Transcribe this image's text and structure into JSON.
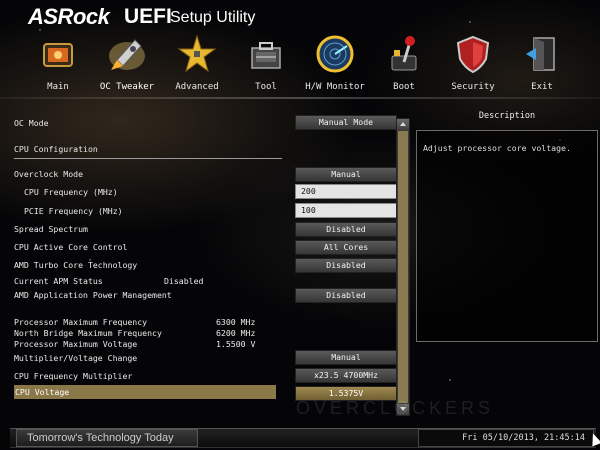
{
  "header": {
    "logo": "ASRock",
    "uefi": "UEFI",
    "subtitle": "Setup Utility"
  },
  "nav": [
    {
      "label": "Main",
      "icon": "main-icon",
      "active": false
    },
    {
      "label": "OC Tweaker",
      "icon": "oc-tweaker-rocket-icon",
      "active": true
    },
    {
      "label": "Advanced",
      "icon": "advanced-star-icon",
      "active": false
    },
    {
      "label": "Tool",
      "icon": "toolbox-icon",
      "active": false
    },
    {
      "label": "H/W Monitor",
      "icon": "radar-icon",
      "active": false
    },
    {
      "label": "Boot",
      "icon": "boot-lever-icon",
      "active": false
    },
    {
      "label": "Security",
      "icon": "shield-icon",
      "active": false
    },
    {
      "label": "Exit",
      "icon": "exit-door-icon",
      "active": false
    }
  ],
  "settings": {
    "oc_mode": {
      "label": "OC Mode",
      "value": "Manual Mode"
    },
    "cpu_configuration": "CPU Configuration",
    "overclock_mode": {
      "label": "Overclock Mode",
      "value": "Manual"
    },
    "cpu_frequency": {
      "label": "CPU Frequency (MHz)",
      "value": "200"
    },
    "pcie_frequency": {
      "label": "PCIE Frequency (MHz)",
      "value": "100"
    },
    "spread_spectrum": {
      "label": "Spread Spectrum",
      "value": "Disabled"
    },
    "cpu_active_core_control": {
      "label": "CPU Active Core Control",
      "value": "All Cores"
    },
    "amd_turbo_core": {
      "label": "AMD Turbo Core Technology",
      "value": "Disabled"
    },
    "current_apm_status": {
      "label": "Current APM Status",
      "value": "Disabled"
    },
    "amd_apm": {
      "label": "AMD Application Power Management",
      "value": "Disabled"
    },
    "processor_max_frequency": {
      "label": "Processor Maximum Frequency",
      "value": "6300 MHz"
    },
    "north_bridge_max_frequency": {
      "label": "North Bridge Maximum Frequency",
      "value": "6200 MHz"
    },
    "processor_max_voltage": {
      "label": "Processor Maximum Voltage",
      "value": "1.5500 V"
    },
    "multiplier_voltage_change": {
      "label": "Multiplier/Voltage Change",
      "value": "Manual"
    },
    "cpu_frequency_multiplier": {
      "label": "CPU Frequency Multiplier",
      "value": "x23.5 4700MHz"
    },
    "cpu_voltage": {
      "label": "CPU Voltage",
      "value": "1.5375V"
    }
  },
  "description": {
    "title": "Description",
    "text": "Adjust processor core voltage."
  },
  "watermark": "OVERCLOCKERS",
  "footer": {
    "tagline": "Tomorrow's Technology Today",
    "datetime": "Fri 05/10/2013, 21:45:14"
  },
  "colors": {
    "highlight": "#8a7848",
    "button": "#4a4a4a",
    "background": "#050507"
  }
}
